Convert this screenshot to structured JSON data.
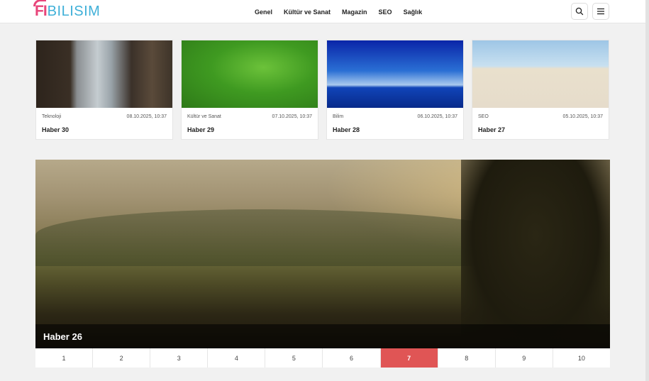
{
  "brand": {
    "mark": "FI",
    "text": "BILISIM",
    "mark_color": "#e8457a",
    "text_color": "#3fb0d8"
  },
  "nav": [
    {
      "label": "Genel"
    },
    {
      "label": "Kültür ve Sanat"
    },
    {
      "label": "Magazin"
    },
    {
      "label": "SEO"
    },
    {
      "label": "Sağlık"
    }
  ],
  "header_buttons": {
    "search_icon": "search-icon",
    "menu_icon": "hamburger-menu-icon"
  },
  "cards": [
    {
      "category": "Teknoloji",
      "date": "08.10.2025, 10:37",
      "title": "Haber 30"
    },
    {
      "category": "Kültür ve Sanat",
      "date": "07.10.2025, 10:37",
      "title": "Haber 29"
    },
    {
      "category": "Bilim",
      "date": "06.10.2025, 10:37",
      "title": "Haber 28"
    },
    {
      "category": "SEO",
      "date": "05.10.2025, 10:37",
      "title": "Haber 27"
    }
  ],
  "slider": {
    "caption": "Haber 26",
    "pages": [
      "1",
      "2",
      "3",
      "4",
      "5",
      "6",
      "7",
      "8",
      "9",
      "10"
    ],
    "active_page": "7",
    "active_color": "#e05555"
  }
}
